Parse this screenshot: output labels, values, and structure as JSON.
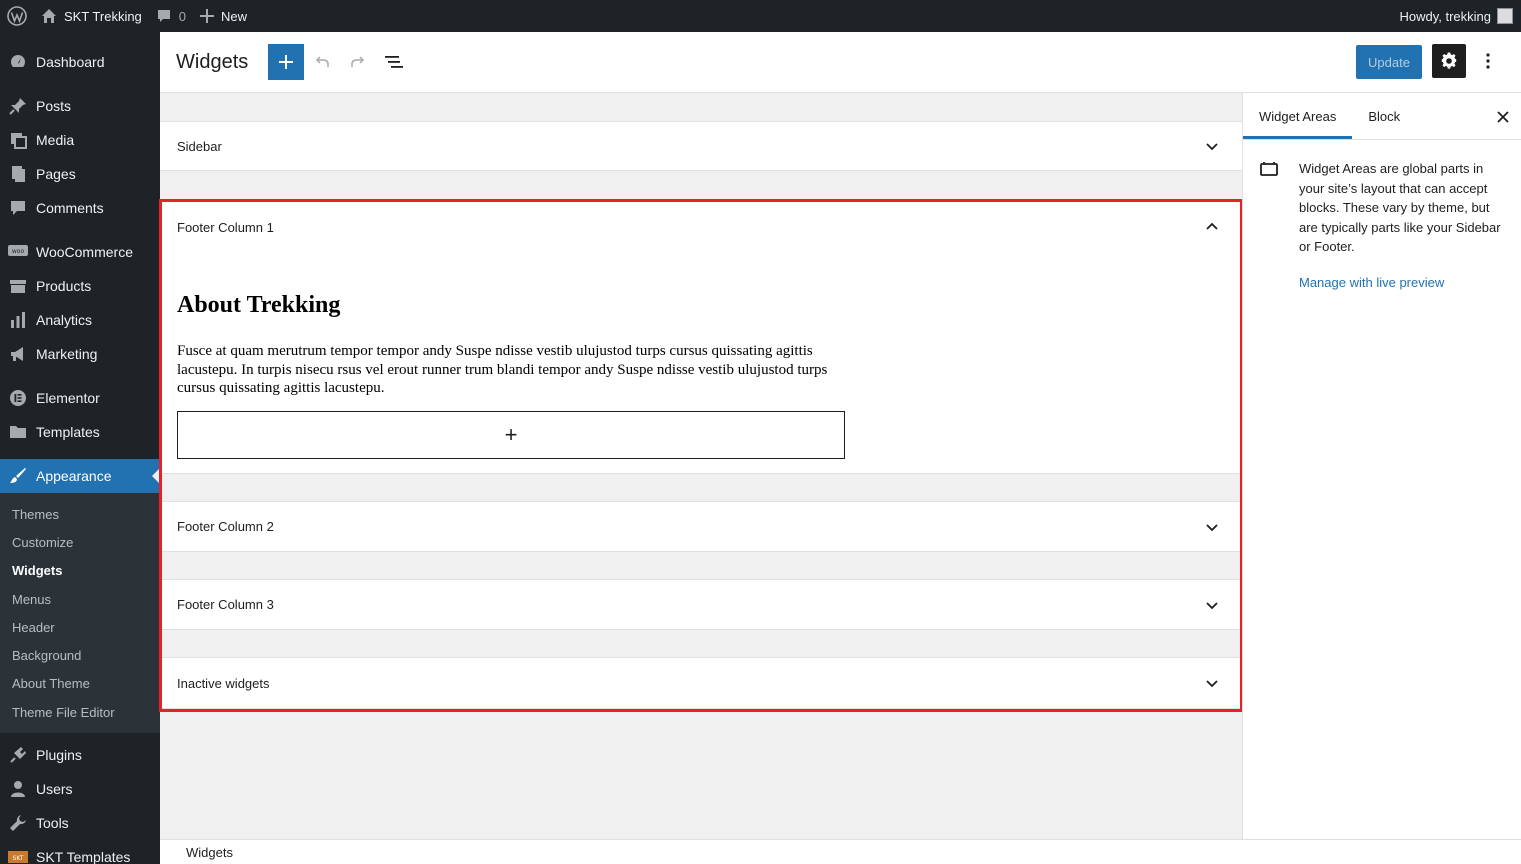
{
  "admin_bar": {
    "site_name": "SKT Trekking",
    "comments_count": "0",
    "new_label": "New",
    "howdy": "Howdy, trekking"
  },
  "menu": {
    "dashboard": "Dashboard",
    "posts": "Posts",
    "media": "Media",
    "pages": "Pages",
    "comments": "Comments",
    "woocommerce": "WooCommerce",
    "products": "Products",
    "analytics": "Analytics",
    "marketing": "Marketing",
    "elementor": "Elementor",
    "templates": "Templates",
    "appearance": "Appearance",
    "submenu": [
      "Themes",
      "Customize",
      "Widgets",
      "Menus",
      "Header",
      "Background",
      "About Theme",
      "Theme File Editor"
    ],
    "plugins": "Plugins",
    "users": "Users",
    "tools": "Tools",
    "skt_templates": "SKT Templates"
  },
  "header": {
    "title": "Widgets",
    "update_label": "Update"
  },
  "areas": {
    "sidebar": "Sidebar",
    "footer1": "Footer Column 1",
    "footer2": "Footer Column 2",
    "footer3": "Footer Column 3",
    "inactive": "Inactive widgets"
  },
  "about": {
    "title": "About Trekking",
    "text": "Fusce at quam merutrum tempor tempor andy Suspe ndisse vestib ulujustod turps cursus quissating agittis lacustepu. In turpis nisecu rsus vel erout runner trum blandi tempor andy Suspe ndisse vestib ulujustod turps cursus quissating agittis lacustepu.",
    "appender": "+"
  },
  "inspector": {
    "tab_widget_areas": "Widget Areas",
    "tab_block": "Block",
    "description": "Widget Areas are global parts in your site’s layout that can accept blocks. These vary by theme, but are typically parts like your Sidebar or Footer.",
    "manage_link": "Manage with live preview"
  },
  "footer": {
    "breadcrumb": "Widgets"
  },
  "colors": {
    "accent": "#2271b1",
    "highlight": "#e8202a",
    "admin_dark": "#1d2327"
  }
}
